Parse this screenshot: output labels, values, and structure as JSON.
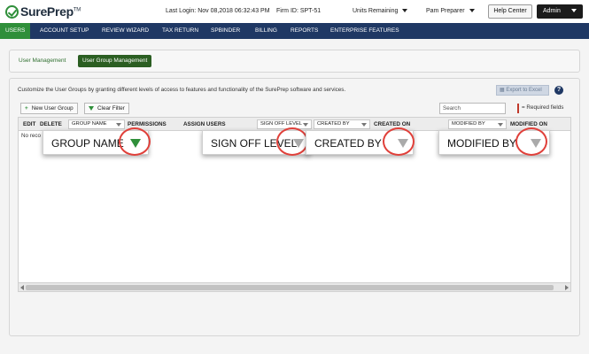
{
  "brand": {
    "name": "SurePrep",
    "tm": "TM"
  },
  "topbar": {
    "last_login": "Last Login: Nov 08,2018 06:32:43 PM",
    "firm_id": "Firm ID:  SPT-51",
    "units_remaining": "Units Remaining",
    "user_menu": "Pam Preparer",
    "help_center": "Help Center",
    "admin": "Admin"
  },
  "nav": [
    "USERS",
    "ACCOUNT SETUP",
    "REVIEW WIZARD",
    "TAX RETURN",
    "SPBINDER",
    "BILLING",
    "REPORTS",
    "ENTERPRISE FEATURES"
  ],
  "subtabs": {
    "user_management": "User Management",
    "user_group_management": "User Group Management"
  },
  "description": "Customize the User Groups by granting different levels of access to features and functionality of the SurePrep software and services.",
  "toolbar": {
    "export": "Export to Excel",
    "help": "?",
    "new_user_group": "New User Group",
    "clear_filter": "Clear Filter",
    "search_placeholder": "Search",
    "required": "= Required fields"
  },
  "grid": {
    "columns": {
      "edit": "EDIT",
      "delete": "DELETE",
      "group_name": "GROUP NAME",
      "permissions": "PERMISSIONS",
      "assign_users": "ASSIGN USERS",
      "sign_off_level": "SIGN OFF LEVEL",
      "created_by": "CREATED BY",
      "created_on": "CREATED ON",
      "modified_by": "MODIFIED BY",
      "modified_on": "MODIFIED ON"
    },
    "empty_text": "No reco"
  },
  "callouts": {
    "group_name": "GROUP NAME",
    "sign_off_level": "SIGN OFF LEVEL",
    "created_by": "CREATED BY",
    "modified_by": "MODIFIED BY"
  },
  "colors": {
    "nav_bg": "#1f3864",
    "active_green": "#2f8f3a",
    "annotation_red": "#e0403a"
  }
}
